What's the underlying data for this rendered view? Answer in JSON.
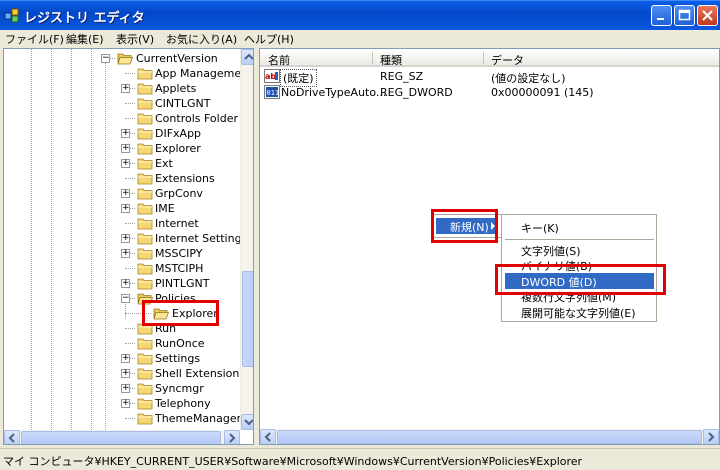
{
  "window": {
    "title": "レジストリ エディタ"
  },
  "menubar": {
    "items": [
      {
        "label": "ファイル(F)"
      },
      {
        "label": "編集(E)"
      },
      {
        "label": "表示(V)"
      },
      {
        "label": "お気に入り(A)"
      },
      {
        "label": "ヘルプ(H)"
      }
    ]
  },
  "tree": {
    "items": [
      {
        "label": "CurrentVersion",
        "expander": "minus",
        "open": true
      },
      {
        "label": "App Management",
        "expander": "none"
      },
      {
        "label": "Applets",
        "expander": "plus"
      },
      {
        "label": "CINTLGNT",
        "expander": "none"
      },
      {
        "label": "Controls Folder",
        "expander": "none"
      },
      {
        "label": "DIFxApp",
        "expander": "plus"
      },
      {
        "label": "Explorer",
        "expander": "plus"
      },
      {
        "label": "Ext",
        "expander": "plus"
      },
      {
        "label": "Extensions",
        "expander": "none"
      },
      {
        "label": "GrpConv",
        "expander": "plus"
      },
      {
        "label": "IME",
        "expander": "plus"
      },
      {
        "label": "Internet",
        "expander": "none"
      },
      {
        "label": "Internet Settings",
        "expander": "plus"
      },
      {
        "label": "MSSCIPY",
        "expander": "plus"
      },
      {
        "label": "MSTCIPH",
        "expander": "none"
      },
      {
        "label": "PINTLGNT",
        "expander": "plus"
      },
      {
        "label": "Policies",
        "expander": "minus",
        "open": true
      },
      {
        "label": "Explorer",
        "expander": "none",
        "open": true,
        "selected": true
      },
      {
        "label": "Run",
        "expander": "none"
      },
      {
        "label": "RunOnce",
        "expander": "none"
      },
      {
        "label": "Settings",
        "expander": "plus"
      },
      {
        "label": "Shell Extensions",
        "expander": "plus"
      },
      {
        "label": "Syncmgr",
        "expander": "plus"
      },
      {
        "label": "Telephony",
        "expander": "plus"
      },
      {
        "label": "ThemeManager",
        "expander": "none"
      }
    ]
  },
  "list": {
    "columns": [
      "名前",
      "種類",
      "データ"
    ],
    "rows": [
      {
        "name": "(既定)",
        "type": "REG_SZ",
        "data": "(値の設定なし)",
        "icon": "string-value-icon"
      },
      {
        "name": "NoDriveTypeAuto...",
        "type": "REG_DWORD",
        "data": "0x00000091 (145)",
        "icon": "binary-value-icon"
      }
    ]
  },
  "context_menu": {
    "new_label": "新規(N)"
  },
  "submenu": {
    "items": [
      "キー(K)",
      "文字列値(S)",
      "バイナリ値(B)",
      "DWORD 値(D)",
      "複数行文字列値(M)",
      "展開可能な文字列値(E)"
    ],
    "highlighted": "DWORD 値(D)"
  },
  "statusbar": {
    "path": "マイ コンピュータ¥HKEY_CURRENT_USER¥Software¥Microsoft¥Windows¥CurrentVersion¥Policies¥Explorer"
  },
  "colors": {
    "titlebar": "#0447c9",
    "highlight": "#316ac5",
    "annotation": "#e00000"
  }
}
